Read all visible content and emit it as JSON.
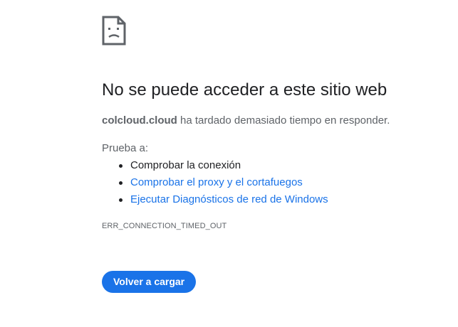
{
  "error_page": {
    "icon": "sad-page-icon",
    "title": "No se puede acceder a este sitio web",
    "summary": {
      "host": "colcloud.cloud",
      "message": " ha tardado demasiado tiempo en responder."
    },
    "try_label": "Prueba a:",
    "suggestions": [
      {
        "label": "Comprobar la conexión",
        "is_link": false
      },
      {
        "label": "Comprobar el proxy y el cortafuegos",
        "is_link": true
      },
      {
        "label": "Ejecutar Diagnósticos de red de Windows",
        "is_link": true
      }
    ],
    "error_code": "ERR_CONNECTION_TIMED_OUT",
    "reload_label": "Volver a cargar"
  },
  "colors": {
    "accent": "#1a73e8",
    "text_primary": "#202124",
    "text_secondary": "#5f6368",
    "background": "#ffffff"
  }
}
